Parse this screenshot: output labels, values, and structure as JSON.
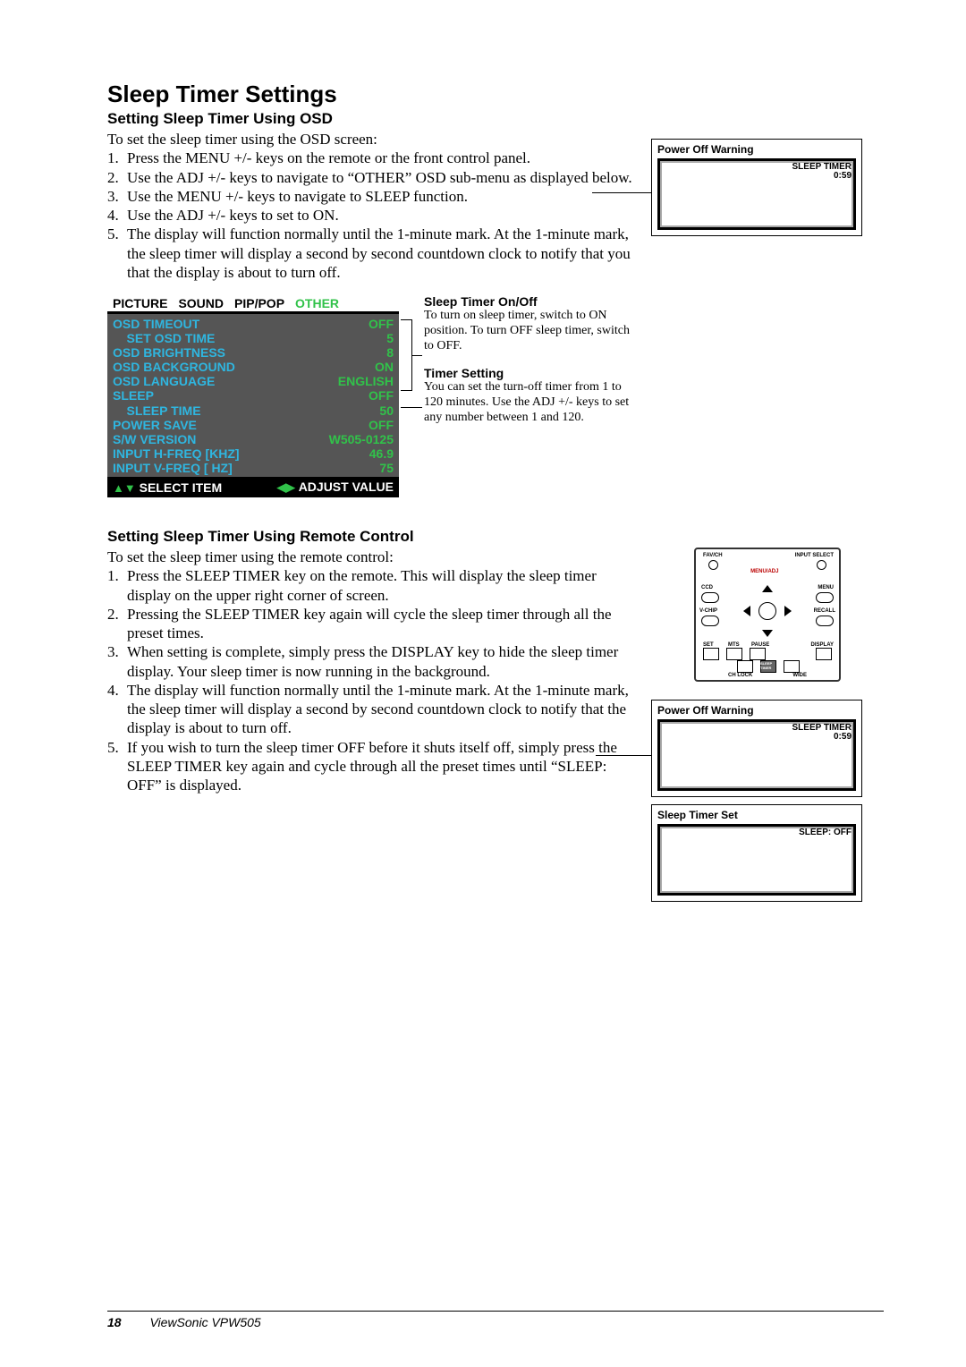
{
  "title": "Sleep Timer Settings",
  "section1": {
    "heading": "Setting Sleep Timer Using OSD",
    "intro": "To set the sleep timer using the OSD screen:",
    "steps": [
      "Press the MENU +/- keys on the remote or the front control panel.",
      "Use the ADJ +/- keys to navigate to “OTHER” OSD sub-menu as displayed below.",
      "Use the MENU +/- keys to navigate to SLEEP function.",
      "Use the ADJ +/- keys to set to ON.",
      "The display will function normally until the 1-minute mark.  At the 1-minute mark, the sleep timer will display a second by second countdown clock to notify that you that the display is about to turn off."
    ]
  },
  "osd": {
    "tabs": [
      "PICTURE",
      "SOUND",
      "PIP/POP",
      "OTHER"
    ],
    "rows": [
      {
        "label": "OSD TIMEOUT",
        "value": "OFF"
      },
      {
        "label": "    SET OSD TIME",
        "value": "5"
      },
      {
        "label": "OSD BRIGHTNESS",
        "value": "8"
      },
      {
        "label": "OSD BACKGROUND",
        "value": "ON"
      },
      {
        "label": "OSD LANGUAGE",
        "value": "ENGLISH"
      },
      {
        "label": "SLEEP",
        "value": "OFF"
      },
      {
        "label": "    SLEEP TIME",
        "value": "50"
      },
      {
        "label": "POWER SAVE",
        "value": "OFF"
      },
      {
        "label": "S/W VERSION",
        "value": "W505-0125"
      },
      {
        "label": "INPUT H-FREQ [KHZ]",
        "value": "46.9"
      },
      {
        "label": "INPUT V-FREQ [  HZ]",
        "value": "75"
      }
    ],
    "footer_left": "SELECT ITEM",
    "footer_right": "ADJUST VALUE"
  },
  "osd_notes": {
    "n1_title": "Sleep Timer On/Off",
    "n1_body": "To turn on sleep timer, switch to ON position.  To turn OFF sleep timer, switch to OFF.",
    "n2_title": "Timer Setting",
    "n2_body": "You can set the turn-off timer from 1 to 120 minutes.  Use the ADJ +/- keys to set any number between 1 and 120."
  },
  "tv1": {
    "title": "Power Off Warning",
    "line1": "SLEEP TIMER",
    "line2": "0:59"
  },
  "tv2": {
    "title": "Power Off Warning",
    "line1": "SLEEP TIMER",
    "line2": "0:59"
  },
  "tv3": {
    "title": "Sleep Timer Set",
    "line": "SLEEP: OFF"
  },
  "remote_labels": {
    "fav": "FAV/CH",
    "input": "INPUT SELECT",
    "ccd": "CCD",
    "menu": "MENU",
    "vchip": "V-CHIP",
    "recall": "RECALL",
    "set": "SET",
    "mts": "MTS",
    "pause": "PAUSE",
    "display": "DISPLAY",
    "chlock": "CH LOCK",
    "sleep": "SLEEP\nTIMER",
    "wide": "WIDE",
    "menuadj": "MENU/ADJ"
  },
  "section2": {
    "heading": "Setting Sleep Timer Using Remote Control",
    "intro": "To set the sleep timer using the remote control:",
    "steps": [
      "Press the SLEEP TIMER key on the remote.  This will display the sleep timer display on the upper right corner of screen.",
      "Pressing the SLEEP TIMER key again will cycle the sleep timer through all the preset times.",
      "When setting is complete, simply press the DISPLAY key to hide the sleep timer display.  Your sleep timer is now running in the background.",
      "The display will function normally until the 1-minute mark.  At the 1-minute mark, the sleep timer will display a second by second countdown clock to notify that the display is about to turn off.",
      "If you wish to turn the sleep timer OFF before it shuts itself off, simply press the SLEEP TIMER key again and cycle through all the preset times until “SLEEP: OFF” is displayed."
    ]
  },
  "footer": {
    "page": "18",
    "product": "ViewSonic  VPW505"
  }
}
